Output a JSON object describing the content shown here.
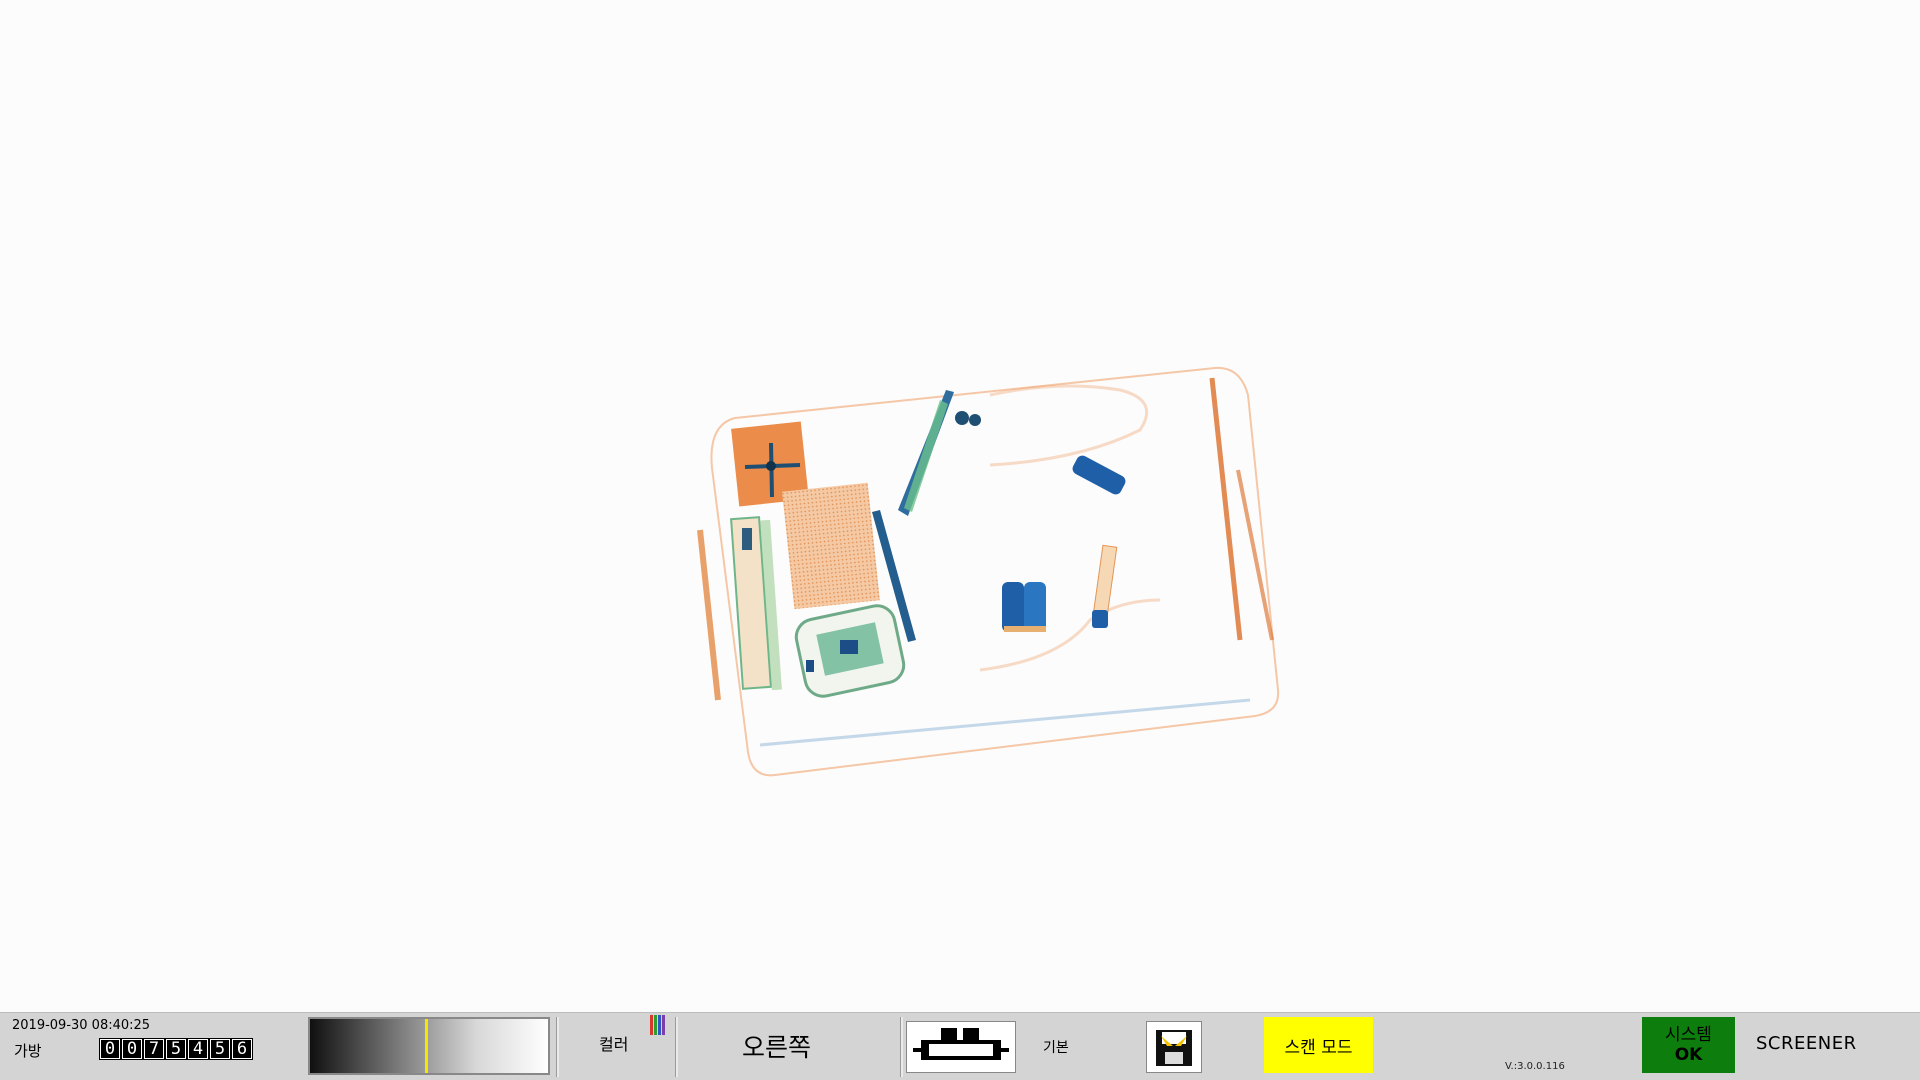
{
  "status_bar": {
    "datetime": "2019-09-30 08:40:25",
    "bag_label": "가방",
    "bag_count_digits": [
      "0",
      "0",
      "7",
      "5",
      "4",
      "5",
      "6"
    ],
    "gray_level_marker": 0.49,
    "color_label": "컬러",
    "color_bars": [
      "#d9382d",
      "#2f9e2f",
      "#3156c8",
      "#7a3fa8"
    ],
    "side_label": "오른쪽",
    "conveyor_icon": "conveyor-belt-icon",
    "basic_label": "기본",
    "save_icon": "save-image-icon",
    "scan_mode_label": "스캔 모드",
    "scan_mode_color": "#ffff00",
    "version": "V.:3.0.0.116",
    "system_label": "시스템",
    "system_status": "OK",
    "system_status_color": "#0d7e0d",
    "role_label": "SCREENER"
  },
  "viewer": {
    "content": "xray-scan-image",
    "palette": {
      "organic": "#e8782a",
      "metal": "#1f5fa8",
      "mixed": "#3aa67a"
    }
  }
}
